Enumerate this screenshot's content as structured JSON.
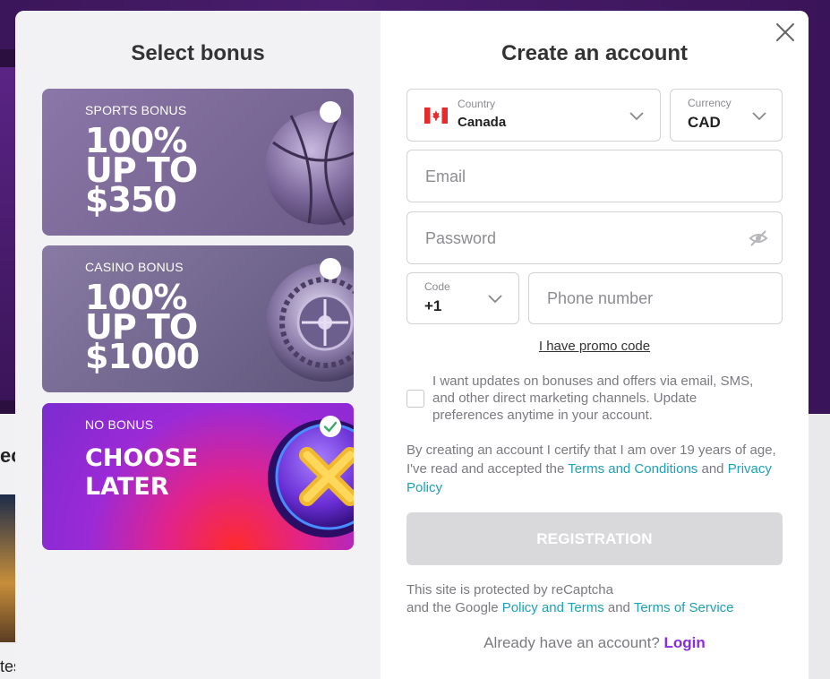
{
  "background": {
    "fragment_1": "ec",
    "fragment_2": "tes"
  },
  "modal": {
    "close_icon": "close-icon"
  },
  "bonus": {
    "title": "Select bonus",
    "cards": [
      {
        "label": "SPORTS BONUS",
        "line1": "100%",
        "line2": "UP TO",
        "line3": "$350",
        "selected": false,
        "art": "basketball"
      },
      {
        "label": "CASINO BONUS",
        "line1": "100%",
        "line2": "UP TO",
        "line3": "$1000",
        "selected": false,
        "art": "roulette"
      },
      {
        "label": "NO BONUS",
        "line1": "CHOOSE",
        "line2": "LATER",
        "selected": true,
        "art": "x-coin"
      }
    ]
  },
  "account": {
    "title": "Create an account",
    "country": {
      "label": "Country",
      "value": "Canada",
      "flag": "canada-flag"
    },
    "currency": {
      "label": "Currency",
      "value": "CAD"
    },
    "email": {
      "placeholder": "Email"
    },
    "password": {
      "placeholder": "Password",
      "toggle_icon": "eye-off-icon"
    },
    "code": {
      "label": "Code",
      "value": "+1"
    },
    "phone": {
      "placeholder": "Phone number"
    },
    "promo_link": "I have promo code",
    "consent_text": "I want updates on bonuses and offers via email, SMS, and other direct marketing channels. Update preferences anytime in your account.",
    "certify": {
      "prefix": "By creating an account I certify that I am over 19 years of age, I've read and accepted the",
      "terms": "Terms and Conditions",
      "and": "and",
      "privacy": "Privacy Policy"
    },
    "register_button": "REGISTRATION",
    "recaptcha": {
      "line1": "This site is protected by reCaptcha",
      "prefix": "and the Google",
      "policy": "Policy and Terms",
      "and": "and",
      "service": "Terms of Service"
    },
    "login": {
      "prompt": "Already have an account?",
      "link": "Login"
    }
  },
  "colors": {
    "accent_link": "#1aa2b6",
    "login_link": "#8a2be2",
    "disabled_button": "#d9d9db"
  }
}
